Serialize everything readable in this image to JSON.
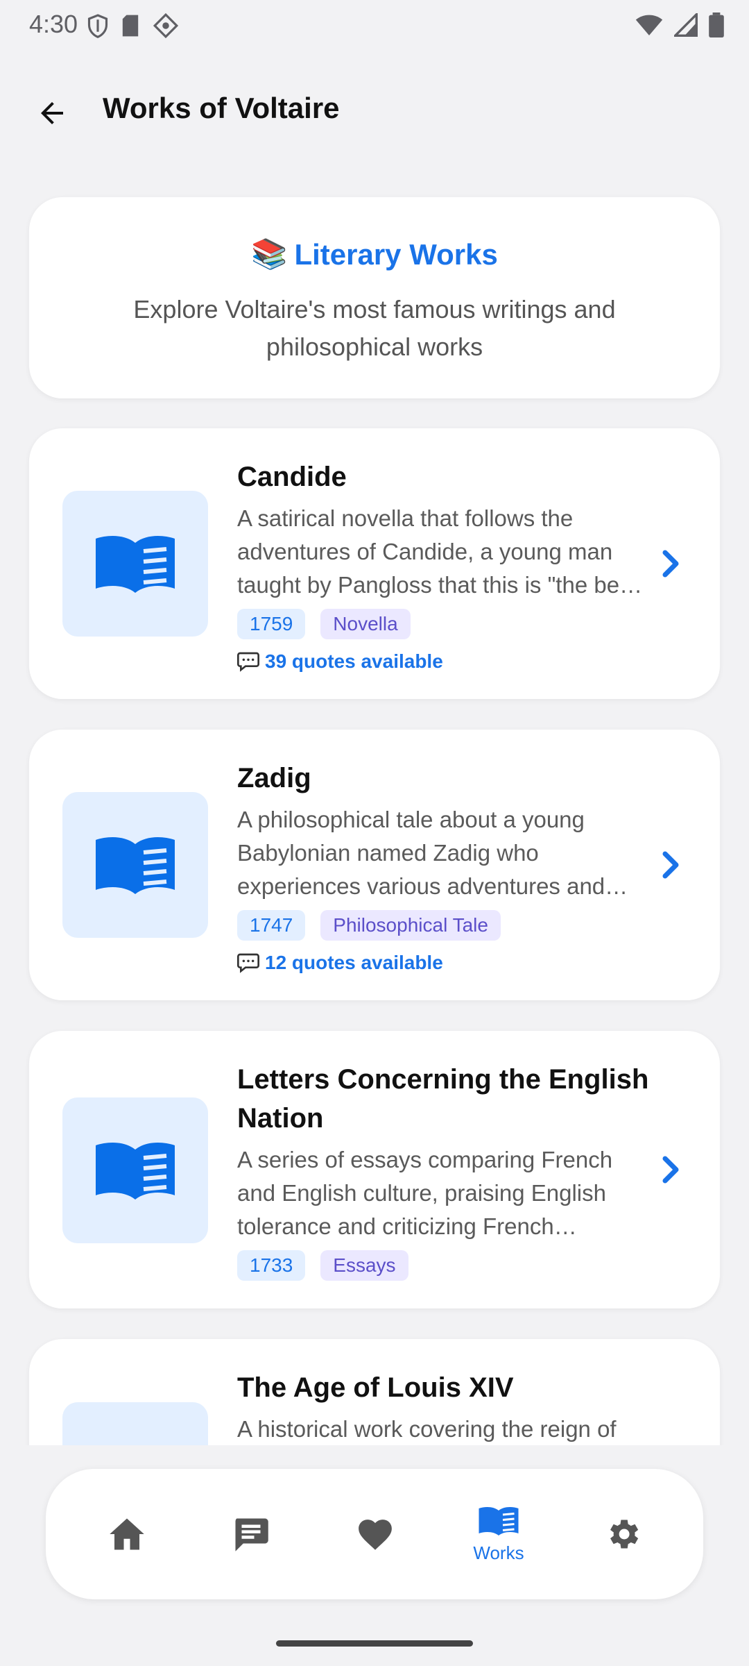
{
  "status_bar": {
    "time": "4:30"
  },
  "header": {
    "title": "Works of Voltaire"
  },
  "intro": {
    "emoji": "📚",
    "title": "Literary Works",
    "subtitle": "Explore Voltaire's most famous writings and philosophical works"
  },
  "works": [
    {
      "title": "Candide",
      "description": "A satirical novella that follows the adventures of Candide, a young man taught by Pangloss that this is \"the best of all possible worlds\"",
      "year": "1759",
      "genre": "Novella",
      "quotes": "39 quotes available"
    },
    {
      "title": "Zadig",
      "description": "A philosophical tale about a young Babylonian named Zadig who experiences various adventures and misfortunes",
      "year": "1747",
      "genre": "Philosophical Tale",
      "quotes": "12 quotes available"
    },
    {
      "title": "Letters Concerning the English Nation",
      "description": "A series of essays comparing French and English culture, praising English tolerance and criticizing French institutions",
      "year": "1733",
      "genre": "Essays"
    },
    {
      "title": "The Age of Louis XIV",
      "description": "A historical work covering the reign of Louis XIV"
    }
  ],
  "nav": {
    "items": [
      {
        "icon": "home-icon"
      },
      {
        "icon": "chat-icon"
      },
      {
        "icon": "heart-icon"
      },
      {
        "icon": "book-icon",
        "label": "Works",
        "active": true
      },
      {
        "icon": "gear-icon"
      }
    ]
  },
  "colors": {
    "accent": "#1a73e8",
    "thumb_bg": "#e3efff",
    "genre_bg": "#ebe8ff",
    "genre_text": "#5b4fc9"
  }
}
